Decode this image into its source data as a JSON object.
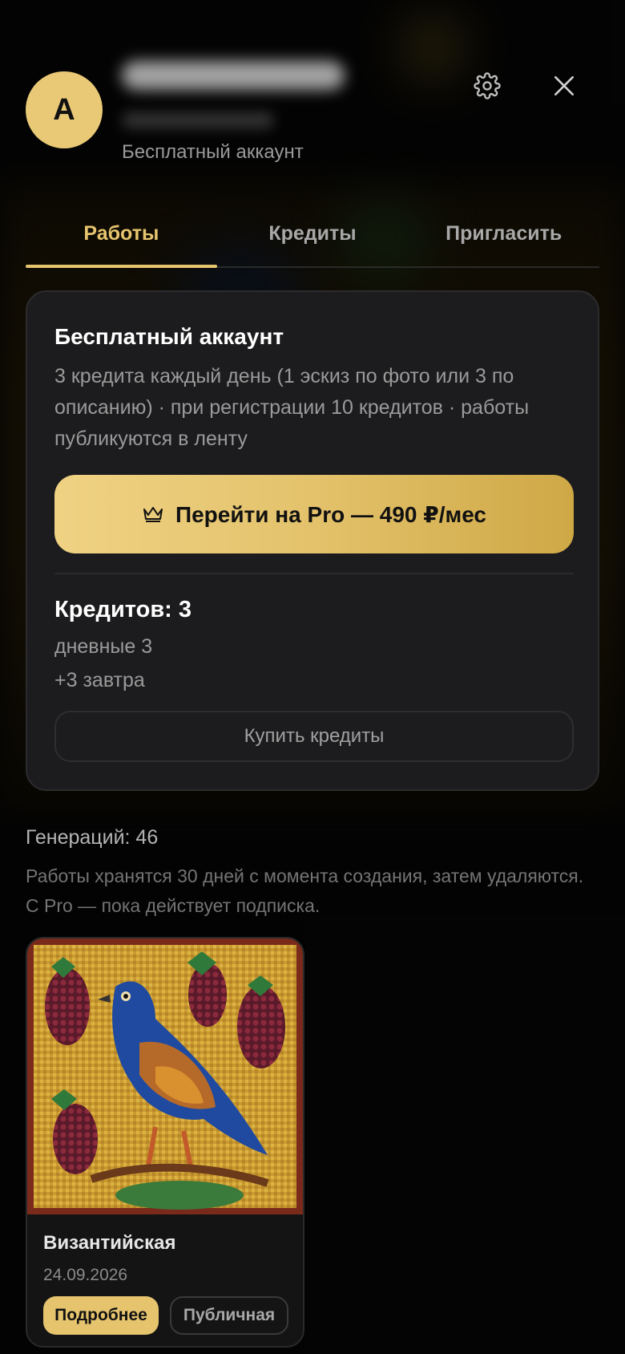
{
  "profile": {
    "avatar_letter": "А",
    "account_type": "Бесплатный аккаунт"
  },
  "icons": {
    "settings": "gear-icon",
    "close": "close-icon",
    "crown": "crown-icon"
  },
  "tabs": [
    {
      "label": "Работы",
      "active": true
    },
    {
      "label": "Кредиты",
      "active": false
    },
    {
      "label": "Пригласить",
      "active": false
    }
  ],
  "plan_card": {
    "title": "Бесплатный аккаунт",
    "description": "3 кредита каждый день (1 эскиз по фото или 3 по описанию) · при регистрации 10 кредитов · работы публикуются в ленту",
    "pro_button": "Перейти на Pro — 490 ₽/мес",
    "credits_title": "Кредитов: 3",
    "daily_credits": "дневные 3",
    "tomorrow_credits": "+3 завтра",
    "buy_button": "Купить кредиты"
  },
  "generations": {
    "count_label": "Генераций: 46",
    "storage_note": "Работы хранятся 30 дней с момента создания, затем удаляются. С Pro — пока действует подписка."
  },
  "works": [
    {
      "title": "Византийская",
      "date": "24.09.2026",
      "details_button": "Подробнее",
      "visibility": "Публичная"
    }
  ],
  "colors": {
    "accent": "#e7c46e",
    "background": "#070707",
    "card": "#1c1c1e"
  }
}
